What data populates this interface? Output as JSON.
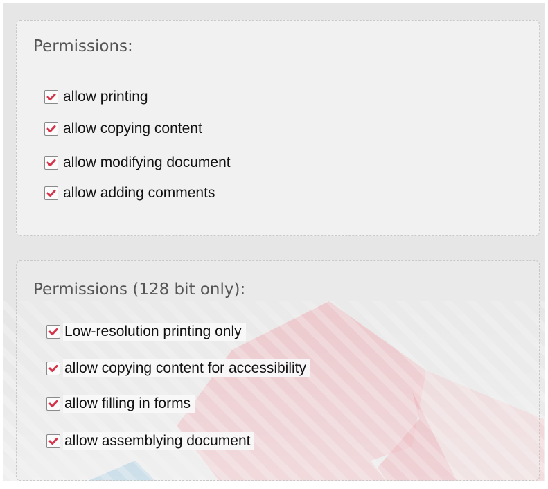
{
  "colors": {
    "checkmark": "#d4344a",
    "panel_title": "#555555",
    "backdrop": "#e6e6e6",
    "decor_red": "#e8a0a8",
    "decor_blue": "#7fb5d4"
  },
  "permissions": {
    "title": "Permissions:",
    "items": [
      {
        "label": "allow printing",
        "checked": true
      },
      {
        "label": "allow copying content",
        "checked": true
      },
      {
        "label": "allow modifying document",
        "checked": true
      },
      {
        "label": "allow adding comments",
        "checked": true
      }
    ]
  },
  "permissions_128": {
    "title": "Permissions (128 bit only):",
    "items": [
      {
        "label": "Low-resolution printing only",
        "checked": true
      },
      {
        "label": "allow copying content for accessibility",
        "checked": true
      },
      {
        "label": "allow filling in forms",
        "checked": true
      },
      {
        "label": "allow assemblying document",
        "checked": true
      }
    ]
  }
}
